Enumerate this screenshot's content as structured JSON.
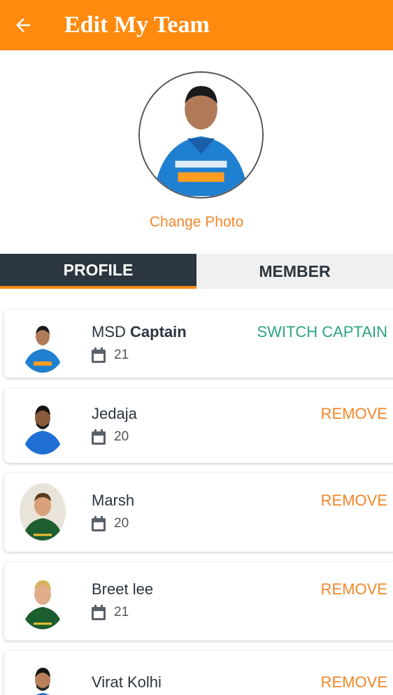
{
  "header": {
    "title": "Edit My Team",
    "back_icon": "arrow-left-icon"
  },
  "profile": {
    "change_photo_label": "Change Photo"
  },
  "tabs": [
    {
      "label": "PROFILE",
      "active": true
    },
    {
      "label": "MEMBER",
      "active": false
    }
  ],
  "members": [
    {
      "name": "MSD",
      "suffix": "Captain",
      "number": "21",
      "action": "SWITCH CAPTAIN"
    },
    {
      "name": "Jedaja",
      "suffix": "",
      "number": "20",
      "action": "REMOVE"
    },
    {
      "name": "Marsh",
      "suffix": "",
      "number": "20",
      "action": "REMOVE"
    },
    {
      "name": "Breet lee",
      "suffix": "",
      "number": "21",
      "action": "REMOVE"
    },
    {
      "name": "Virat Kolhi",
      "suffix": "",
      "number": "",
      "action": "REMOVE"
    }
  ],
  "colors": {
    "accent": "#ff8a0e",
    "tab_dark": "#2b3640",
    "switch_green": "#2aa57f",
    "remove_orange": "#f2872a"
  }
}
